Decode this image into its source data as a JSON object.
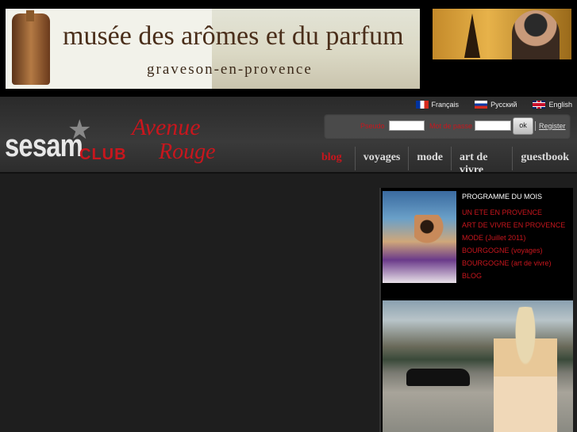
{
  "banner": {
    "title": "musée des arômes et du parfum",
    "subtitle": "graveson-en-provence"
  },
  "languages": [
    {
      "label": "Français",
      "flag": "flag-fr"
    },
    {
      "label": "Русский",
      "flag": "flag-ru"
    },
    {
      "label": "English",
      "flag": "flag-gb"
    }
  ],
  "login": {
    "pseudo_label": "Pseudo",
    "password_label": "Mot de passe",
    "pseudo_value": "",
    "password_value": "",
    "ok_label": "ok",
    "register_label": "Register"
  },
  "logo": {
    "sesam": "sesam",
    "club": "CLUB",
    "avenue": "Avenue",
    "rouge": "Rouge"
  },
  "nav": {
    "items": [
      "blog",
      "voyages",
      "mode",
      "art de vivre",
      "guestbook"
    ],
    "active": "blog"
  },
  "sidebar": {
    "programme_title": "PROGRAMME DU MOIS",
    "links": [
      "UN ETE EN PROVENCE",
      "ART DE VIVRE EN PROVENCE",
      "MODE (Juillet 2011)",
      "BOURGOGNE (voyages)",
      "BOURGOGNE (art de vivre)",
      "BLOG"
    ]
  },
  "colors": {
    "accent": "#c8161d",
    "background": "#1e1e1e",
    "header": "#2a2a2a"
  }
}
